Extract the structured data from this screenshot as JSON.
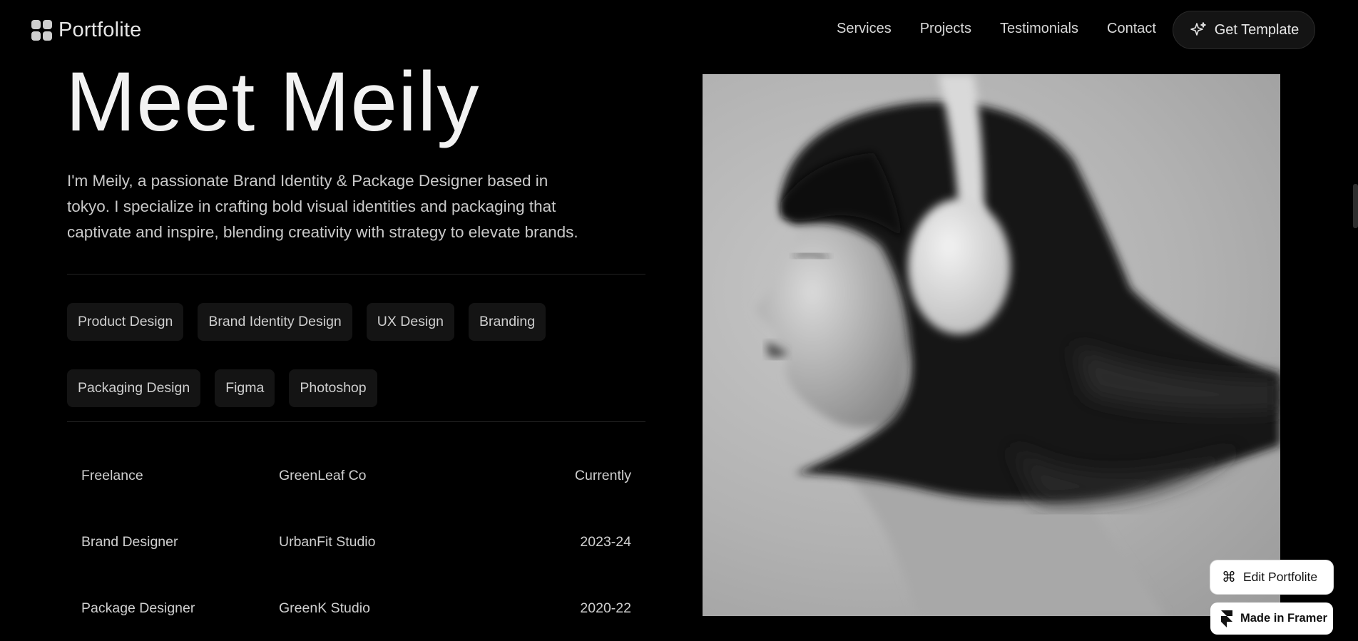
{
  "header": {
    "logo_text": "Portfolite",
    "nav": [
      {
        "label": "Services"
      },
      {
        "label": "Projects"
      },
      {
        "label": "Testimonials"
      },
      {
        "label": "Contact"
      }
    ],
    "cta_label": "Get Template"
  },
  "hero": {
    "title": "Meet Meily",
    "bio": "I'm Meily, a passionate Brand Identity & Package Designer based in tokyo. I specialize in crafting bold visual identities and packaging that captivate and inspire, blending creativity with strategy to elevate brands."
  },
  "skills": [
    "Product Design",
    "Brand Identity Design",
    "UX Design",
    "Branding",
    "Packaging Design",
    "Figma",
    "Photoshop"
  ],
  "experience": [
    {
      "role": "Freelance",
      "company": "GreenLeaf Co",
      "period": "Currently"
    },
    {
      "role": "Brand Designer",
      "company": "UrbanFit Studio",
      "period": "2023-24"
    },
    {
      "role": "Package Designer",
      "company": "GreenK Studio",
      "period": "2020-22"
    }
  ],
  "badges": {
    "edit_label": "Edit Portfolite",
    "framer_label": "Made in Framer"
  },
  "colors": {
    "background": "#000000",
    "tag_background": "#141414",
    "text_muted": "#c9c9c9"
  }
}
